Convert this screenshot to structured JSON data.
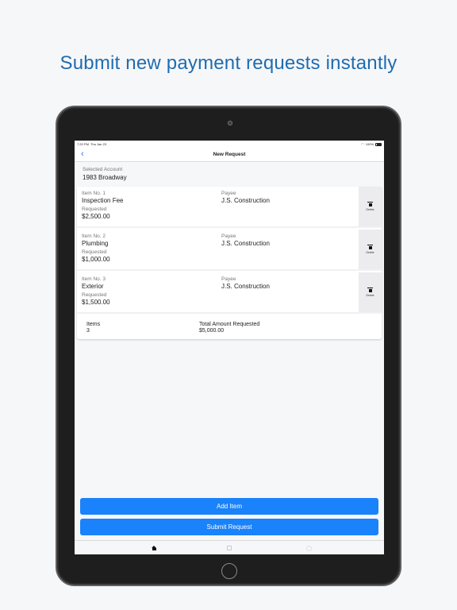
{
  "headline": "Submit new payment requests instantly",
  "status_bar": {
    "time": "7:20 PM",
    "date": "Thu Jan 23",
    "battery": "100%"
  },
  "nav": {
    "title": "New Request"
  },
  "account": {
    "label": "Selected Account",
    "value": "1983 Broadway"
  },
  "items": [
    {
      "number_label": "Item No. 1",
      "name": "Inspection Fee",
      "requested_label": "Requested",
      "amount": "$2,500.00",
      "payee_label": "Payee",
      "payee": "J.S. Construction",
      "delete_label": "Delete"
    },
    {
      "number_label": "Item No. 2",
      "name": "Plumbing",
      "requested_label": "Requested",
      "amount": "$1,000.00",
      "payee_label": "Payee",
      "payee": "J.S. Construction",
      "delete_label": "Delete"
    },
    {
      "number_label": "Item No. 3",
      "name": "Exterior",
      "requested_label": "Requested",
      "amount": "$1,500.00",
      "payee_label": "Payee",
      "payee": "J.S. Construction",
      "delete_label": "Delete"
    }
  ],
  "summary": {
    "items_label": "Items",
    "items_count": "3",
    "total_label": "Total Amount Requested",
    "total_value": "$5,000.00"
  },
  "buttons": {
    "add_item": "Add Item",
    "submit_request": "Submit Request"
  },
  "tabbar": {
    "icons": [
      "home-icon",
      "profile-icon",
      "settings-icon"
    ]
  },
  "colors": {
    "accent": "#1a82fb",
    "headline": "#1f6cb0"
  }
}
